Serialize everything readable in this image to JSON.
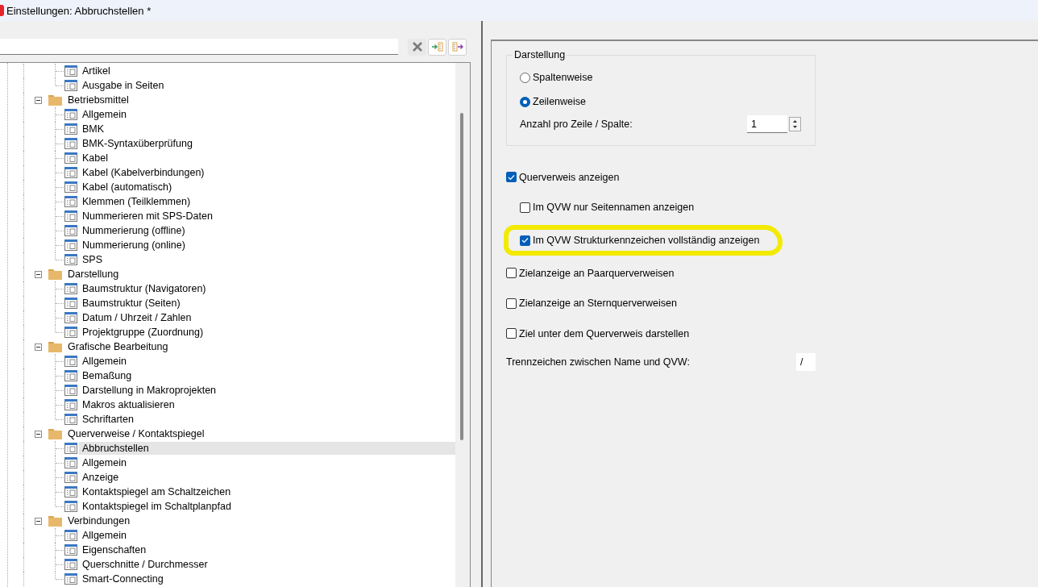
{
  "window": {
    "title": "Einstellungen: Abbruchstellen *"
  },
  "tree": [
    {
      "children": [
        {
          "label": "Artikel",
          "selected": false
        },
        {
          "label": "Ausgabe in Seiten",
          "selected": false
        }
      ]
    },
    {
      "label": "Betriebsmittel",
      "expanded": true,
      "children": [
        {
          "label": "Allgemein",
          "selected": false
        },
        {
          "label": "BMK",
          "selected": false
        },
        {
          "label": "BMK-Syntaxüberprüfung",
          "selected": false
        },
        {
          "label": "Kabel",
          "selected": false
        },
        {
          "label": "Kabel (Kabelverbindungen)",
          "selected": false
        },
        {
          "label": "Kabel (automatisch)",
          "selected": false
        },
        {
          "label": "Klemmen (Teilklemmen)",
          "selected": false
        },
        {
          "label": "Nummerieren mit SPS-Daten",
          "selected": false
        },
        {
          "label": "Nummerierung (offline)",
          "selected": false
        },
        {
          "label": "Nummerierung (online)",
          "selected": false
        },
        {
          "label": "SPS",
          "selected": false
        }
      ]
    },
    {
      "label": "Darstellung",
      "expanded": true,
      "children": [
        {
          "label": "Baumstruktur (Navigatoren)",
          "selected": false
        },
        {
          "label": "Baumstruktur (Seiten)",
          "selected": false
        },
        {
          "label": "Datum / Uhrzeit / Zahlen",
          "selected": false
        },
        {
          "label": "Projektgruppe (Zuordnung)",
          "selected": false
        }
      ]
    },
    {
      "label": "Grafische Bearbeitung",
      "expanded": true,
      "children": [
        {
          "label": "Allgemein",
          "selected": false
        },
        {
          "label": "Bemaßung",
          "selected": false
        },
        {
          "label": "Darstellung in Makroprojekten",
          "selected": false
        },
        {
          "label": "Makros aktualisieren",
          "selected": false
        },
        {
          "label": "Schriftarten",
          "selected": false
        }
      ]
    },
    {
      "label": "Querverweise / Kontaktspiegel",
      "expanded": true,
      "children": [
        {
          "label": "Abbruchstellen",
          "selected": true
        },
        {
          "label": "Allgemein",
          "selected": false
        },
        {
          "label": "Anzeige",
          "selected": false
        },
        {
          "label": "Kontaktspiegel am Schaltzeichen",
          "selected": false
        },
        {
          "label": "Kontaktspiegel im Schaltplanpfad",
          "selected": false
        }
      ]
    },
    {
      "label": "Verbindungen",
      "expanded": true,
      "children": [
        {
          "label": "Allgemein",
          "selected": false
        },
        {
          "label": "Eigenschaften",
          "selected": false
        },
        {
          "label": "Querschnitte / Durchmesser",
          "selected": false
        },
        {
          "label": "Smart-Connecting",
          "selected": false
        }
      ]
    }
  ],
  "darstellung": {
    "title": "Darstellung",
    "options": [
      {
        "label": "Spaltenweise",
        "selected": false
      },
      {
        "label": "Zeilenweise",
        "selected": true
      }
    ],
    "count_label": "Anzahl pro Zeile / Spalte:",
    "count_value": "1"
  },
  "options": [
    {
      "label": "Querverweis anzeigen",
      "checked": true,
      "children": [
        {
          "label": "Im QVW nur Seitennamen anzeigen",
          "checked": false,
          "highlighted": false
        },
        {
          "label": "Im QVW Strukturkennzeichen vollständig anzeigen",
          "checked": true,
          "highlighted": true
        }
      ]
    },
    {
      "label": "Zielanzeige an Paarquerverweisen",
      "checked": false
    },
    {
      "label": "Zielanzeige an Sternquerverweisen",
      "checked": false
    },
    {
      "label": "Ziel unter dem Querverweis darstellen",
      "checked": false
    }
  ],
  "separator": {
    "label": "Trennzeichen zwischen Name und QVW:",
    "value": "/"
  }
}
